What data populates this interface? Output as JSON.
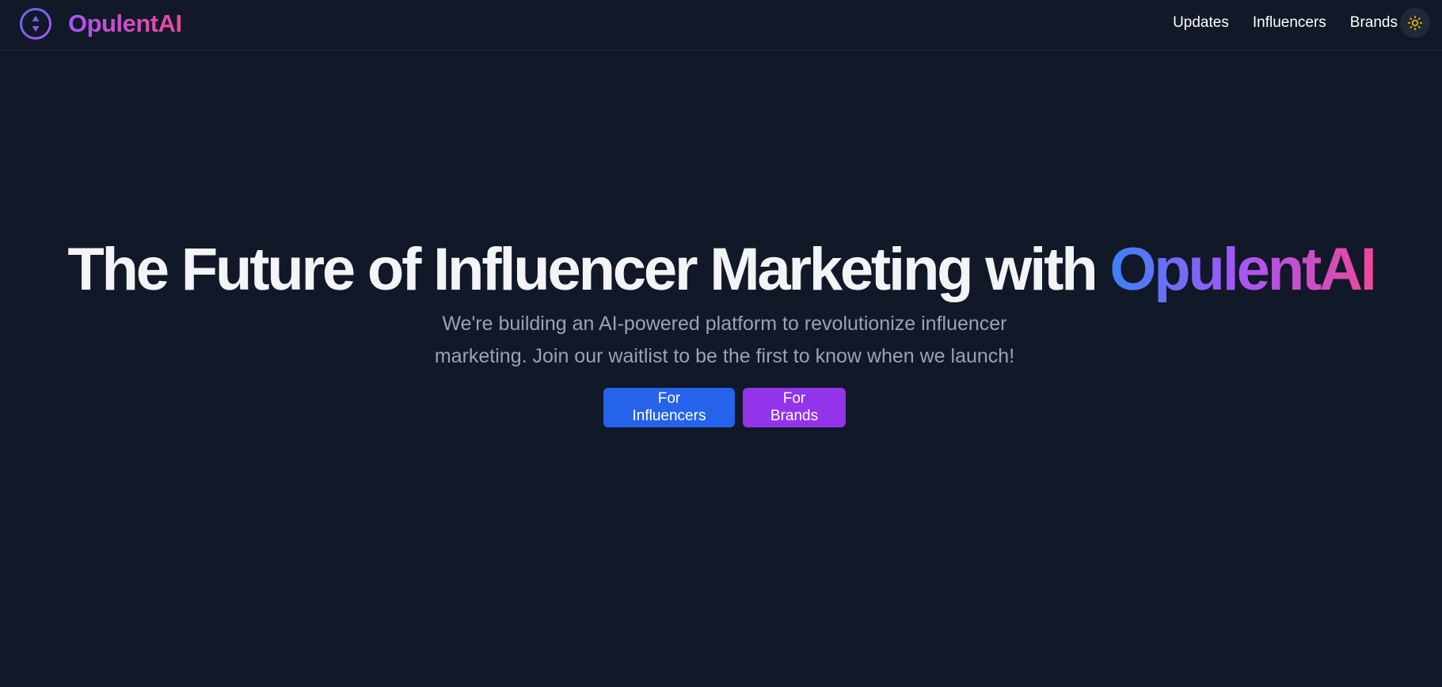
{
  "header": {
    "brand_name": "OpulentAI",
    "nav": [
      {
        "label": "Updates"
      },
      {
        "label": "Influencers"
      },
      {
        "label": "Brands"
      }
    ],
    "theme_toggle_icon": "sun-icon"
  },
  "hero": {
    "title_main": "The Future of Influencer Marketing with ",
    "title_accent": "OpulentAI",
    "subtitle": "We're building an AI-powered platform to revolutionize influencer marketing. Join our waitlist to be the first to know when we launch!",
    "buttons": [
      {
        "label": "For Influencers"
      },
      {
        "label": "For Brands"
      }
    ]
  },
  "colors": {
    "background": "#111827",
    "primary_button": "#2563eb",
    "secondary_button": "#9333ea",
    "accent_gradient_start": "#3b82f6",
    "accent_gradient_mid": "#a855f7",
    "accent_gradient_end": "#ec4899",
    "sun_icon": "#eab308"
  }
}
